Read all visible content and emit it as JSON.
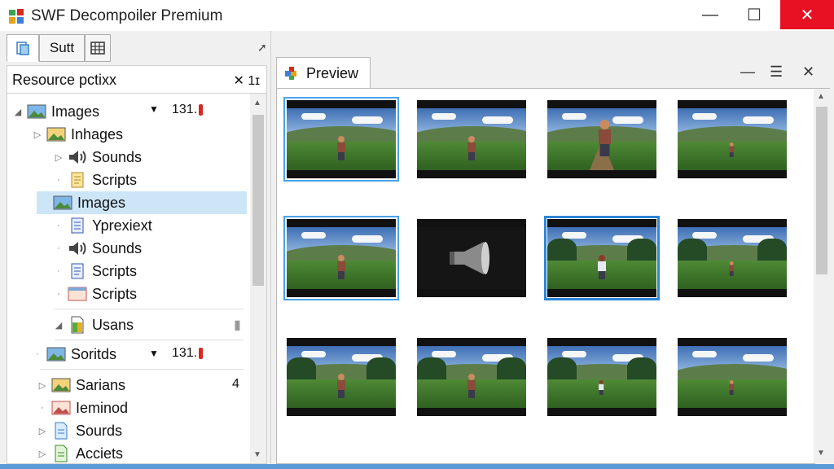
{
  "window": {
    "title": "SWF Decompoiler Premium",
    "min_glyph": "—",
    "max_glyph": "☐",
    "close_glyph": "✕"
  },
  "left_panel": {
    "tab_label": "Sutt",
    "pin_glyph": "➚",
    "resource_label": "Resource pctixx",
    "resource_count": "✕ 1ɪ",
    "tree": [
      {
        "label": "Images",
        "icon": "image-icon",
        "expanded": true,
        "tail": "131.",
        "level": 0
      },
      {
        "label": "Inhages",
        "icon": "image-icon",
        "level": 1
      },
      {
        "label": "Sounds",
        "icon": "speaker-icon",
        "level": 2
      },
      {
        "label": "Scripts",
        "icon": "script-icon",
        "level": 2
      },
      {
        "label": "Images",
        "icon": "image-icon",
        "level": 2,
        "selected": true
      },
      {
        "label": "Yprexiext",
        "icon": "text-icon",
        "level": 2
      },
      {
        "label": "Sounds",
        "icon": "speaker-icon",
        "level": 2
      },
      {
        "label": "Scripts",
        "icon": "script-icon",
        "level": 2
      },
      {
        "label": "Scripts",
        "icon": "frame-icon",
        "level": 2
      },
      {
        "label": "Usans",
        "icon": "document-icon",
        "level": 1
      },
      {
        "label": "Soritds",
        "icon": "image-icon",
        "level": 1,
        "tail": "131."
      },
      {
        "label": "Sarians",
        "icon": "image-icon",
        "level": 1,
        "tail": "4"
      },
      {
        "label": "Ieminod",
        "icon": "image-icon",
        "level": 1
      },
      {
        "label": "Sourds",
        "icon": "document-icon",
        "level": 1
      },
      {
        "label": "Acciets",
        "icon": "document-icon",
        "level": 1
      }
    ]
  },
  "preview": {
    "tab_label": "Preview",
    "tools": [
      "—",
      "☰",
      "✕"
    ],
    "thumbnails": [
      {
        "scene": "field-character",
        "selected": "light"
      },
      {
        "scene": "field-character"
      },
      {
        "scene": "path-character-close"
      },
      {
        "scene": "field-character-far"
      },
      {
        "scene": "field-character",
        "selected": "light"
      },
      {
        "scene": "dark-megaphone"
      },
      {
        "scene": "forest-girl",
        "selected": "strong"
      },
      {
        "scene": "forest-character-far"
      },
      {
        "scene": "forest-character"
      },
      {
        "scene": "forest-character"
      },
      {
        "scene": "forest-girl-far"
      },
      {
        "scene": "field-character-far"
      }
    ]
  },
  "colors": {
    "accent": "#2f86d6",
    "selection": "#cde6f7",
    "close_button": "#e81123",
    "red_marker": "#d9281f"
  }
}
